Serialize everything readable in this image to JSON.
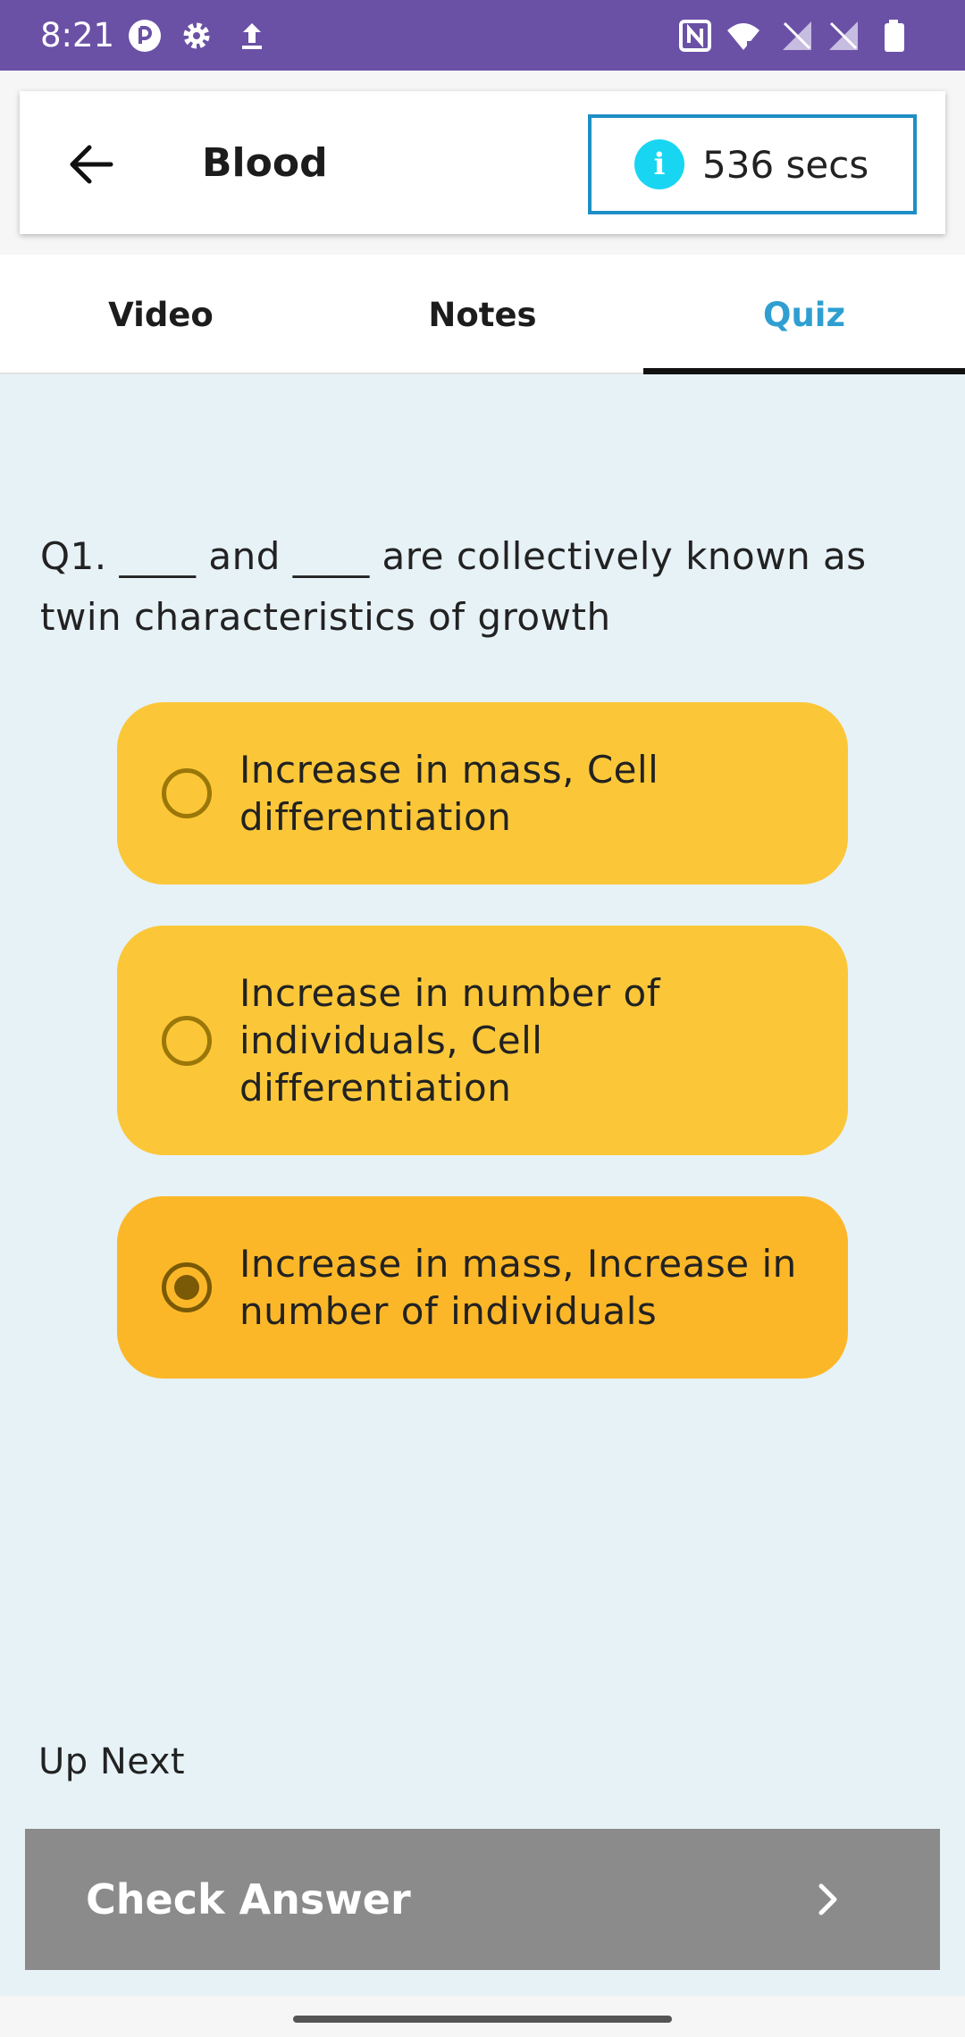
{
  "status_bar": {
    "time": "8:21",
    "icons": [
      "record-icon",
      "gear-icon",
      "upload-icon",
      "nfc-icon",
      "wifi-icon",
      "no-signal-icon",
      "no-signal-icon",
      "battery-icon"
    ]
  },
  "header": {
    "title": "Blood",
    "timer_text": "536 secs",
    "info_glyph": "i"
  },
  "tabs": [
    {
      "label": "Video"
    },
    {
      "label": "Notes"
    },
    {
      "label": "Quiz",
      "active": true
    }
  ],
  "quiz": {
    "question": "Q1. ____ and ____ are collectively known as twin characteristics of growth",
    "options": [
      {
        "label": "Increase in mass, Cell differentiation",
        "selected": false
      },
      {
        "label": "Increase in number of individuals, Cell differentiation",
        "selected": false
      },
      {
        "label": "Increase in mass, Increase in number of individuals",
        "selected": true
      }
    ]
  },
  "footer": {
    "up_next": "Up Next",
    "check_label": "Check Answer"
  },
  "colors": {
    "status_bar": "#6a51a6",
    "accent": "#2f9fd1",
    "option": "#fbc738",
    "option_selected": "#fcb728",
    "check_button": "#8b8b8b"
  }
}
